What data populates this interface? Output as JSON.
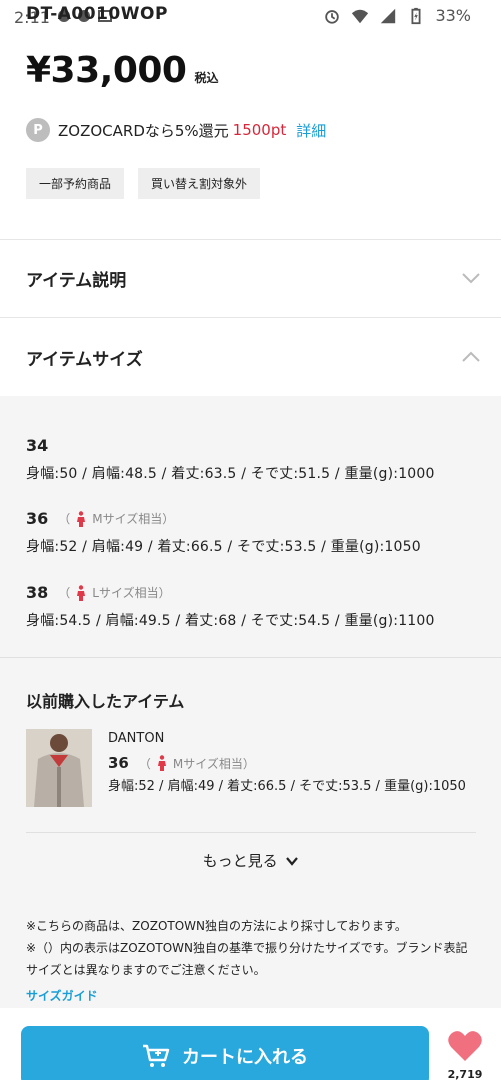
{
  "status_bar": {
    "time": "2:11",
    "overlay_title": "DT-A0010WOP",
    "battery": "33%"
  },
  "price": {
    "amount": "¥33,000",
    "tax_label": "税込"
  },
  "zozocard": {
    "icon_letter": "P",
    "text": "ZOZOCARDなら5%還元",
    "points": "1500pt",
    "detail_link": "詳細"
  },
  "tags": [
    "一部予約商品",
    "買い替え割対象外"
  ],
  "accordions": {
    "description_label": "アイテム説明",
    "size_label": "アイテムサイズ"
  },
  "sizes": [
    {
      "size": "34",
      "hint": "",
      "detail": "身幅:50 / 肩幅:48.5 / 着丈:63.5 / そで丈:51.5 / 重量(g):1000"
    },
    {
      "size": "36",
      "hint": "Mサイズ相当",
      "detail": "身幅:52 / 肩幅:49 / 着丈:66.5 / そで丈:53.5 / 重量(g):1050"
    },
    {
      "size": "38",
      "hint": "Lサイズ相当",
      "detail": "身幅:54.5 / 肩幅:49.5 / 着丈:68 / そで丈:54.5 / 重量(g):1100"
    }
  ],
  "previous": {
    "title": "以前購入したアイテム",
    "brand": "DANTON",
    "size": "36",
    "hint": "Mサイズ相当",
    "detail": "身幅:52 / 肩幅:49 / 着丈:66.5 / そで丈:53.5 / 重量(g):1050",
    "more_label": "もっと見る"
  },
  "notes": {
    "line1": "※こちらの商品は、ZOZOTOWN独自の方法により採寸しております。",
    "line2": "※（）内の表示はZOZOTOWN独自の基準で振り分けたサイズです。ブランド表記サイズとは異なりますのでご注意ください。",
    "guide_link": "サイズガイド"
  },
  "bottom": {
    "cart_label": "カートに入れる",
    "fav_count": "2,719"
  },
  "colors": {
    "accent": "#29a8dd",
    "points_red": "#d6283a",
    "link_blue": "#1a9ed6",
    "heart": "#f07080"
  }
}
